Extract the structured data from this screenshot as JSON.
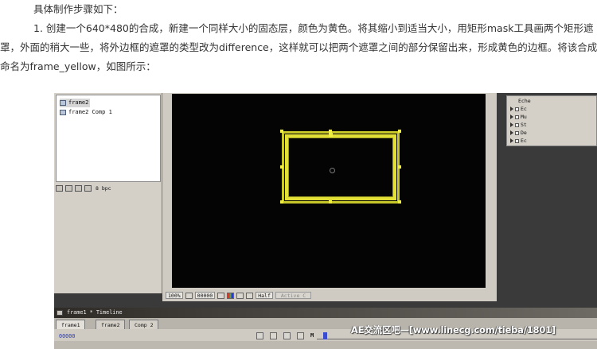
{
  "article": {
    "heading": "具体制作步骤如下：",
    "paragraph_line1": "1. 创建一个640*480的合成，新建一个同样大小的固态层，颜色为黄色。将其缩小到适当大小，用矩形mask工具画两个矩形遮",
    "paragraph_line2": "罩，外面的稍大一些，将外边框的遮罩的类型改为difference，这样就可以把两个遮罩之间的部分保留出来，形成黄色的边框。将该合成",
    "paragraph_line3": "命名为frame_yellow，如图所示："
  },
  "screenshot": {
    "project_panel": {
      "items": [
        "frame2",
        "frame2 Comp 1"
      ],
      "bpc_label": "8 bpc"
    },
    "viewer": {
      "zoom": "100%",
      "timecode": "00000",
      "resolution": "Half",
      "view_mode": "Active C",
      "frame_color": "#e2e036"
    },
    "effects_panel": {
      "header": "Eche",
      "items": [
        "Ec",
        "Mu",
        "St",
        "De",
        "Ec"
      ]
    },
    "timeline": {
      "title": "frame1 * Timeline",
      "tabs": [
        "frame1",
        "frame2",
        "Comp 2"
      ],
      "time": "00000",
      "marker_label": "M"
    },
    "watermark": "AE交流区吧—[www.linecg.com/tieba/1801]"
  }
}
